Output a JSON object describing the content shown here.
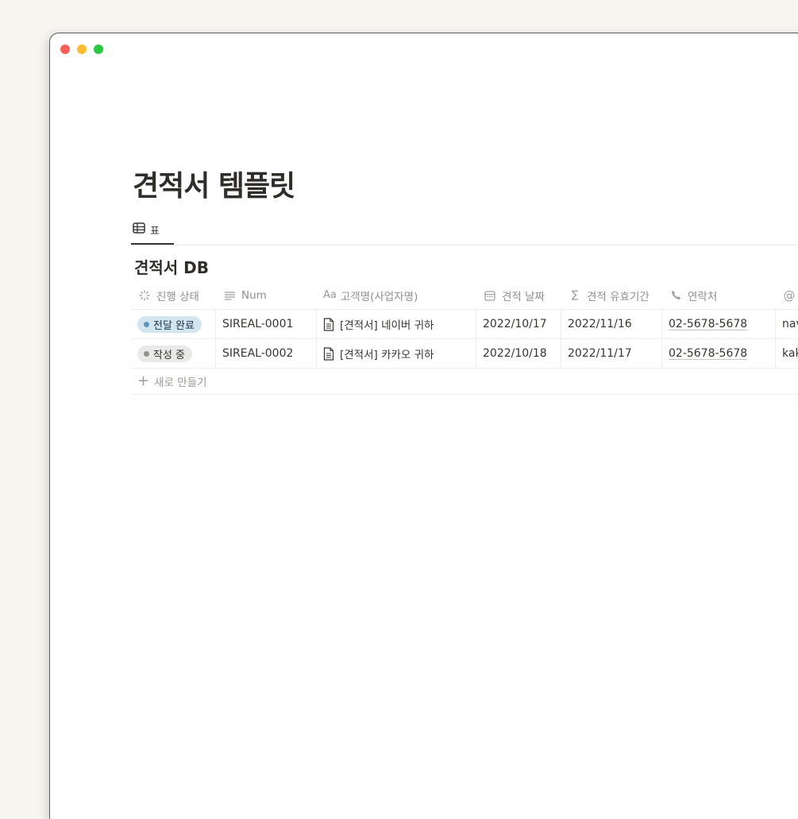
{
  "page": {
    "title": "견적서 템플릿",
    "view_tab_label": "표",
    "db_title": "견적서 DB"
  },
  "table": {
    "columns": [
      {
        "label": "진행 상태",
        "icon": "status-icon"
      },
      {
        "label": "Num",
        "icon": "text-lines-icon"
      },
      {
        "label": "고객명(사업자명)",
        "icon": "title-aa-icon",
        "icon_text": "Aa"
      },
      {
        "label": "견적 날짜",
        "icon": "calendar-icon"
      },
      {
        "label": "견적 유효기간",
        "icon": "formula-sigma-icon",
        "icon_text": "∑"
      },
      {
        "label": "연락처",
        "icon": "phone-icon"
      },
      {
        "label": "",
        "icon": "email-at-icon",
        "icon_text": "@"
      }
    ],
    "rows": [
      {
        "status": "전달 완료",
        "status_color": "blue",
        "num": "SIREAL-0001",
        "name": "[견적서] 네이버 귀하",
        "date": "2022/10/17",
        "valid_until": "2022/11/16",
        "phone": "02-5678-5678",
        "email": "nav"
      },
      {
        "status": "작성 중",
        "status_color": "gray",
        "num": "SIREAL-0002",
        "name": "[견적서] 카카오 귀하",
        "date": "2022/10/18",
        "valid_until": "2022/11/17",
        "phone": "02-5678-5678",
        "email": "kak"
      }
    ],
    "new_row_label": "새로 만들기"
  },
  "colors": {
    "status_blue_bg": "#d3e5ef",
    "status_gray_bg": "#e9e9e7",
    "traffic_red": "#ff5f57",
    "traffic_yellow": "#febc2e",
    "traffic_green": "#28c840"
  }
}
